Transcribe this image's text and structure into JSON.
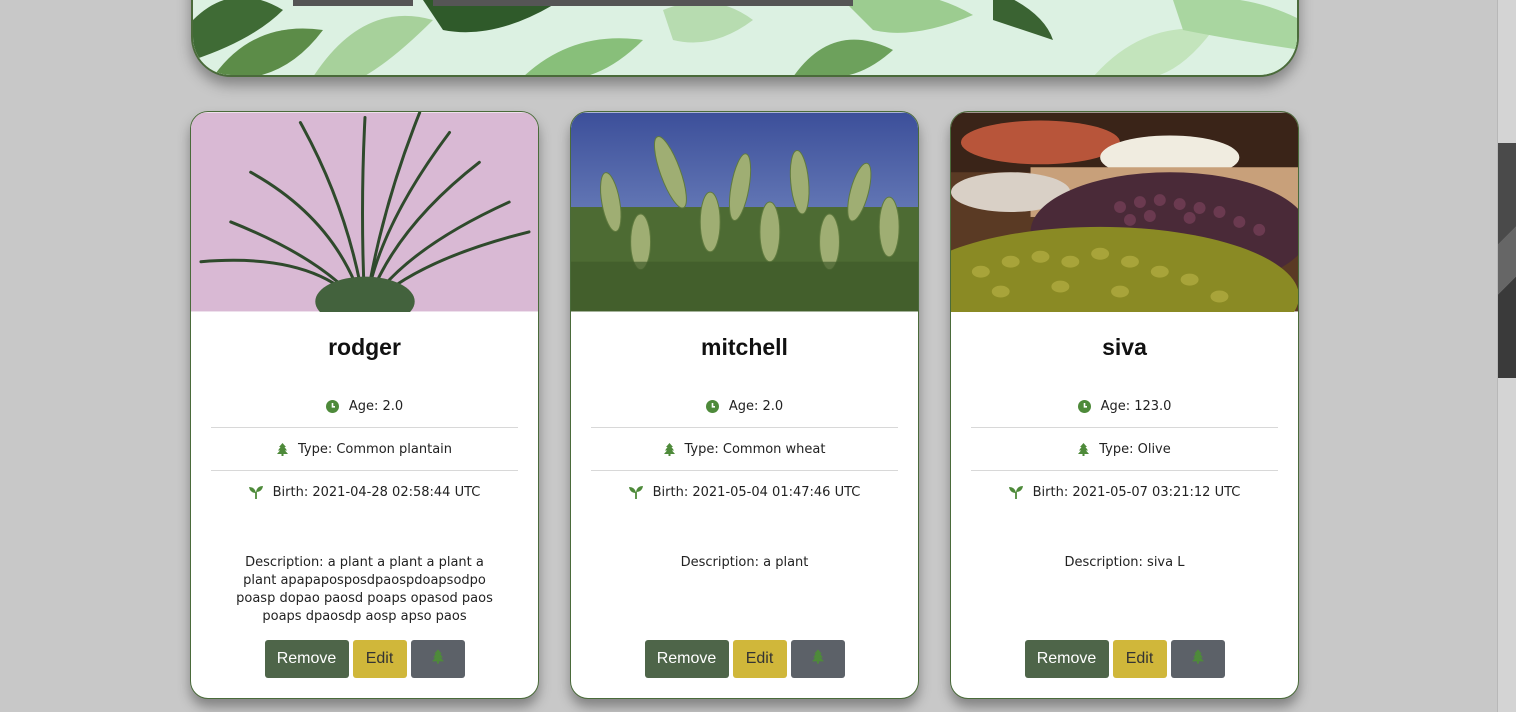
{
  "plants": [
    {
      "name": "rodger",
      "age": "Age: 2.0",
      "type": "Type: Common plantain",
      "birth": "Birth: 2021-04-28 02:58:44 UTC",
      "description": "Description: a plant a plant a plant a plant apapaposposdpaospdoapsodpo poasp dopao paosd poaps opasod paos poaps dpaosdp aosp apso paos",
      "image_subject": "spiky green plant on pink background"
    },
    {
      "name": "mitchell",
      "age": "Age: 2.0",
      "type": "Type: Common wheat",
      "birth": "Birth: 2021-05-04 01:47:46 UTC",
      "description": "Description: a plant",
      "image_subject": "wheat field under blue sky"
    },
    {
      "name": "siva",
      "age": "Age: 123.0",
      "type": "Type: Olive",
      "birth": "Birth: 2021-05-07 03:21:12 UTC",
      "description": "Description: siva L",
      "image_subject": "market bins of olives and spices"
    }
  ],
  "buttons": {
    "remove_label": "Remove",
    "edit_label": "Edit",
    "tree_icon": "tree-icon"
  },
  "icons": {
    "age": "clock-icon",
    "type": "tree-icon",
    "birth": "seedling-icon"
  },
  "colors": {
    "accent_green": "#4e6549",
    "edit_yellow": "#d0b73a",
    "icon_green": "#4e8a3a",
    "tree_button": "#5c6168"
  }
}
